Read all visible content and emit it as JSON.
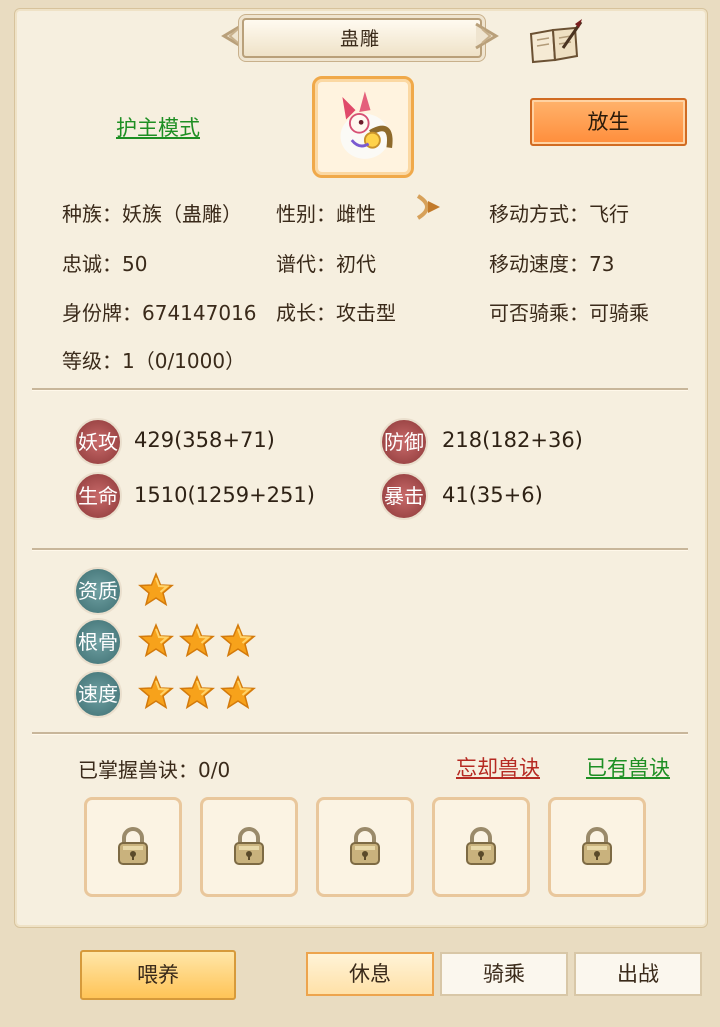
{
  "header": {
    "title": "蛊雕"
  },
  "top": {
    "guard_mode_link": "护主模式",
    "release_button": "放生"
  },
  "info": {
    "species": "种族：妖族（蛊雕）",
    "gender": "性别：雌性",
    "movement": "移动方式：飞行",
    "loyalty": "忠诚：50",
    "lineage": "谱代：初代",
    "move_speed": "移动速度：73",
    "id_tag": "身份牌：674147016",
    "growth": "成长：攻击型",
    "rideable": "可否骑乘：可骑乘",
    "level": "等级：1（0/1000）"
  },
  "stats": {
    "attack": {
      "label": "妖攻",
      "value": "429(358+71)"
    },
    "defense": {
      "label": "防御",
      "value": "218(182+36)"
    },
    "hp": {
      "label": "生命",
      "value": "1510(1259+251)"
    },
    "crit": {
      "label": "暴击",
      "value": "41(35+6)"
    }
  },
  "ratings": [
    {
      "label": "资质",
      "stars": 1
    },
    {
      "label": "根骨",
      "stars": 3
    },
    {
      "label": "速度",
      "stars": 3
    }
  ],
  "skills": {
    "mastered": "已掌握兽诀：0/0",
    "forget_link": "忘却兽诀",
    "owned_link": "已有兽诀",
    "slot_count": 5
  },
  "bottom": {
    "feed_button": "喂养",
    "tabs": [
      "休息",
      "骑乘",
      "出战"
    ],
    "active_tab": "休息"
  },
  "icons": [
    "book-quill-icon",
    "arrow-right-icon",
    "lock-icon",
    "star-icon"
  ]
}
